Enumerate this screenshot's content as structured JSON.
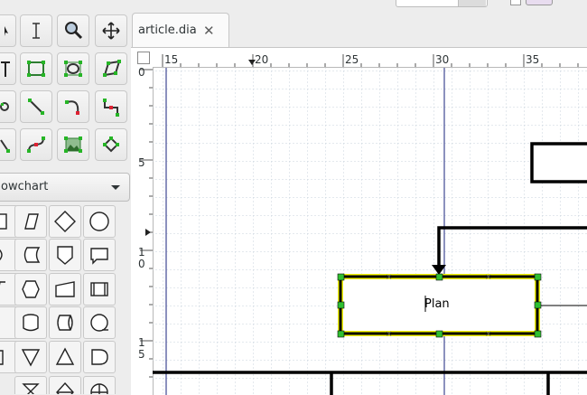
{
  "tab": {
    "title": "article.dia",
    "close_glyph": "✕"
  },
  "sheet_selector": {
    "value": "Flowchart",
    "visible_text": "owchart"
  },
  "ruler": {
    "h_labels": [
      "15",
      "20",
      "25",
      "30",
      "35"
    ],
    "v_labels": [
      "0",
      "5",
      "1\n0",
      "1\n5"
    ]
  },
  "diagram": {
    "selected_box_label": "Plan",
    "selection_color": "#f4f40a",
    "handle_color": "#2fc02f"
  },
  "tools": [
    "pointer-icon",
    "text-cursor-icon",
    "magnify-icon",
    "move-icon",
    "text-tool-icon",
    "box-icon",
    "ellipse-icon",
    "polygon-icon",
    "beziergon-icon",
    "line-icon",
    "arc-icon",
    "zigzag-icon",
    "polyline-icon",
    "bezier-icon",
    "image-icon",
    "outline-icon"
  ]
}
